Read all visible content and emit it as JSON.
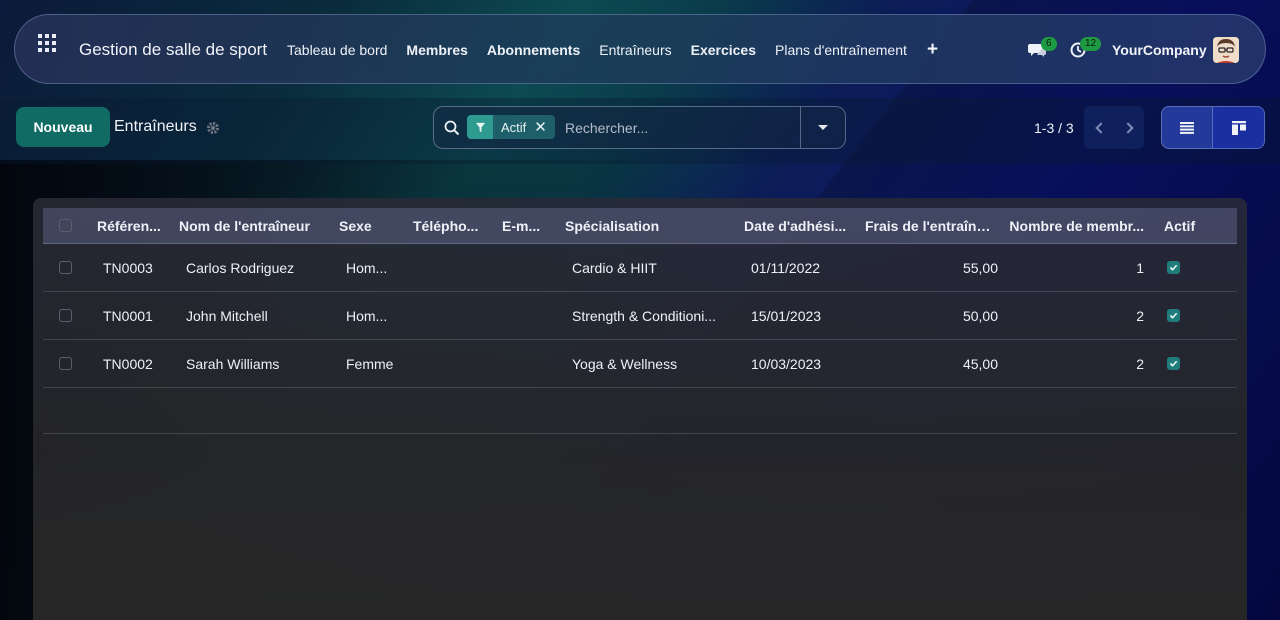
{
  "navbar": {
    "app_title": "Gestion de salle de sport",
    "menu": [
      {
        "label": "Tableau de bord",
        "bold": false
      },
      {
        "label": "Membres",
        "bold": true
      },
      {
        "label": "Abonnements",
        "bold": true
      },
      {
        "label": "Entraîneurs",
        "bold": false
      },
      {
        "label": "Exercices",
        "bold": true
      },
      {
        "label": "Plans d'entraînement",
        "bold": false
      }
    ],
    "plus_label": "+",
    "messages_count": "6",
    "activities_count": "12",
    "company": "YourCompany"
  },
  "control": {
    "new_label": "Nouveau",
    "breadcrumb": "Entraîneurs",
    "search": {
      "facet_label": "Actif",
      "facet_close": "✕",
      "placeholder": "Rechercher..."
    },
    "pager": "1-3 / 3"
  },
  "table": {
    "headers": {
      "ref": "Référen...",
      "name": "Nom de l'entraîneur",
      "sex": "Sexe",
      "phone": "Télépho...",
      "email": "E-m...",
      "spec": "Spécialisation",
      "date": "Date d'adhési...",
      "fee": "Frais de l'entraîneur",
      "count": "Nombre de membr...",
      "active": "Actif"
    },
    "rows": [
      {
        "ref": "TN0003",
        "name": "Carlos Rodriguez",
        "sex": "Hom...",
        "phone": "",
        "email": "",
        "spec": "Cardio & HIIT",
        "date": "01/11/2022",
        "fee": "55,00",
        "count": "1",
        "active": true
      },
      {
        "ref": "TN0001",
        "name": "John Mitchell",
        "sex": "Hom...",
        "phone": "",
        "email": "",
        "spec": "Strength & Conditioni...",
        "date": "15/01/2023",
        "fee": "50,00",
        "count": "2",
        "active": true
      },
      {
        "ref": "TN0002",
        "name": "Sarah Williams",
        "sex": "Femme",
        "phone": "",
        "email": "",
        "spec": "Yoga & Wellness",
        "date": "10/03/2023",
        "fee": "45,00",
        "count": "2",
        "active": true
      }
    ]
  },
  "colors": {
    "primary": "#0f6b63",
    "badge": "#1e9a43",
    "checkbox_on": "#1f7c7a"
  }
}
